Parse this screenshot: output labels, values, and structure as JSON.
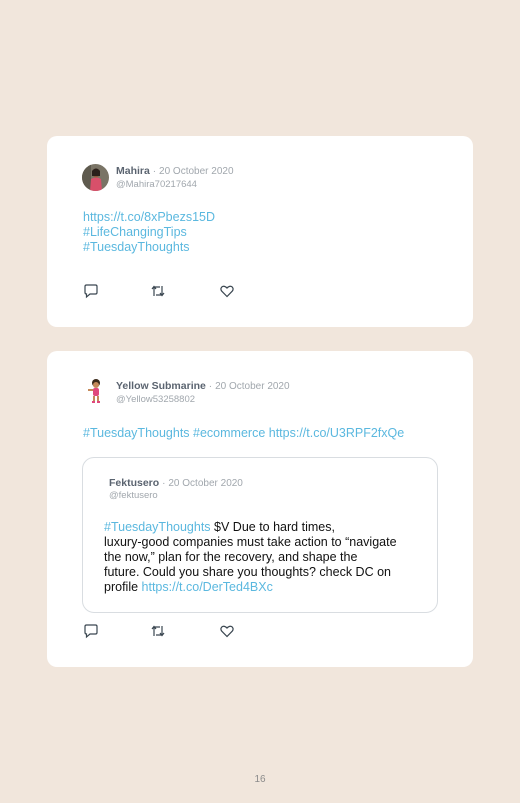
{
  "tweets": [
    {
      "author": "Mahira",
      "separator": "·",
      "date": "20 October 2020",
      "handle": "@Mahira70217644",
      "lines": [
        "https://t.co/8xPbezs15D",
        "#LifeChangingTips",
        "#TuesdayThoughts"
      ],
      "avatar_icon": "profile-photo"
    },
    {
      "author": "Yellow Submarine",
      "separator": "·",
      "date": "20 October 2020",
      "handle": "@Yellow53258802",
      "lines": [
        "#TuesdayThoughts #ecommerce https://t.co/U3RPF2fxQe"
      ],
      "avatar_icon": "cartoon-character",
      "quoted": {
        "author": "Fektusero",
        "separator": "·",
        "date": "20 October 2020",
        "handle": "@fektusero",
        "text": {
          "hashtag": "#TuesdayThoughts",
          "line1_rest": " $V Due to hard times,",
          "line2": "luxury-good companies must take action to “navigate",
          "line3": "the now,” plan for the recovery, and shape the",
          "line4": "future. Could you share you thoughts? check DC on",
          "line5_start": "profile ",
          "link": "https://t.co/DerTed4BXc"
        }
      }
    }
  ],
  "actions": [
    "reply-icon",
    "retweet-icon",
    "like-icon"
  ],
  "colors": {
    "link": "#5bb8df",
    "background": "#f1e6dc",
    "card": "#ffffff"
  },
  "page_number": "16"
}
